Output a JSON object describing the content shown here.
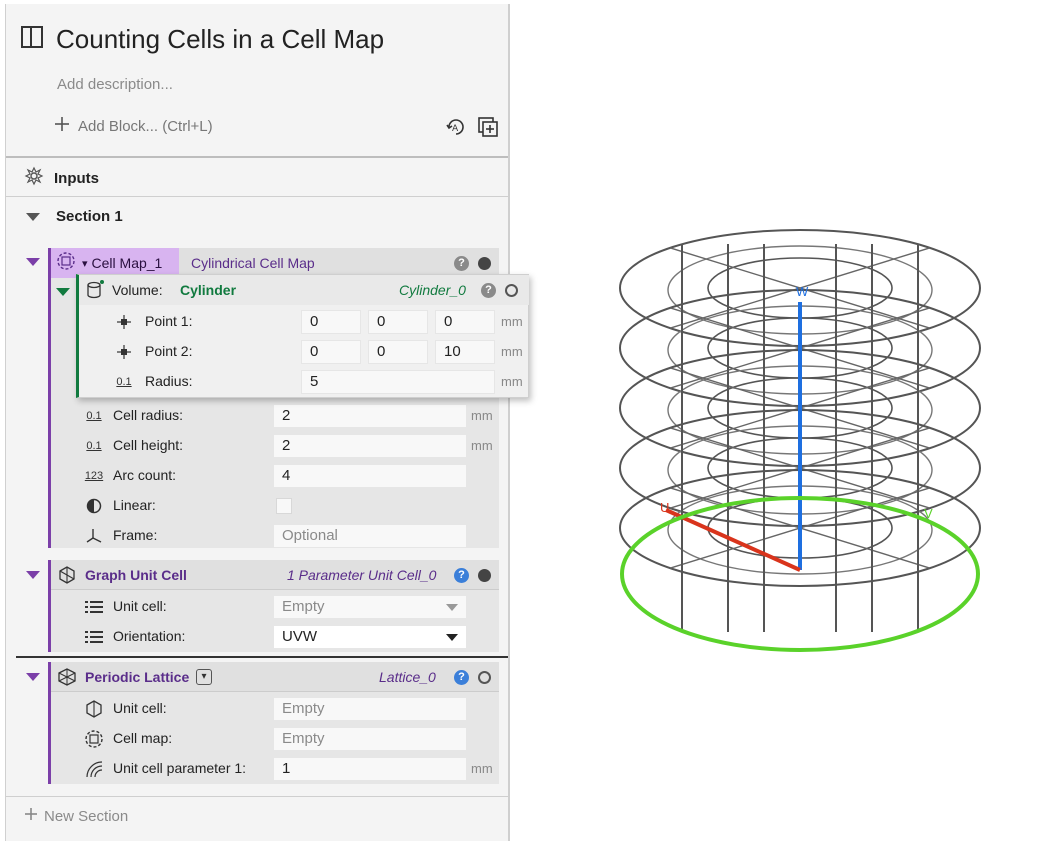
{
  "document": {
    "title": "Counting Cells in a Cell Map",
    "description_placeholder": "Add description...",
    "add_block": "Add Block... (Ctrl+L)"
  },
  "inputs": {
    "label": "Inputs"
  },
  "section": {
    "label": "Section 1"
  },
  "cell_map": {
    "tab_name": "Cell Map_1",
    "type": "Cylindrical Cell Map",
    "params": [
      {
        "label": "Cell radius:",
        "value": "2",
        "unit": "mm"
      },
      {
        "label": "Cell height:",
        "value": "2",
        "unit": "mm"
      },
      {
        "label": "Arc count:",
        "value": "4"
      },
      {
        "label": "Linear:"
      },
      {
        "label": "Frame:",
        "placeholder": "Optional"
      }
    ]
  },
  "volume": {
    "label": "Volume:",
    "type": "Cylinder",
    "name": "Cylinder_0",
    "point1": {
      "label": "Point 1:",
      "values": [
        "0",
        "0",
        "0"
      ],
      "unit": "mm"
    },
    "point2": {
      "label": "Point 2:",
      "values": [
        "0",
        "0",
        "10"
      ],
      "unit": "mm"
    },
    "radius": {
      "label": "Radius:",
      "value": "5",
      "unit": "mm"
    }
  },
  "graph_unit_cell": {
    "name": "Graph Unit Cell",
    "instance": "1 Parameter Unit Cell_0",
    "unit_cell": {
      "label": "Unit cell:",
      "value": "Empty"
    },
    "orientation": {
      "label": "Orientation:",
      "value": "UVW"
    }
  },
  "periodic_lattice": {
    "name": "Periodic Lattice",
    "instance": "Lattice_0",
    "unit_cell": {
      "label": "Unit cell:",
      "value": "Empty"
    },
    "cell_map": {
      "label": "Cell map:",
      "value": "Empty"
    },
    "param": {
      "label": "Unit cell parameter 1:",
      "value": "1",
      "unit": "mm"
    }
  },
  "new_section": "New Section",
  "viewer": {
    "axis_w": "W",
    "axis_u": "U",
    "axis_v": "V",
    "colors": {
      "w_axis": "#1e6fe0",
      "u_axis": "#d9341c",
      "base_ring": "#5ad22a",
      "wire": "#555555"
    }
  },
  "icons": {
    "panel": "panel-toggle-icon",
    "add": "plus-icon",
    "inputs": "gear-nodes-icon",
    "cellmap": "cell-map-icon",
    "cylinder": "cylinder-icon",
    "point": "point-icon",
    "scalar": "scalar-icon",
    "integer": "integer-icon",
    "contrast": "half-circle-icon",
    "frame": "frame-axes-icon",
    "list": "list-icon",
    "lattice": "lattice-icon",
    "help": "help-icon"
  }
}
